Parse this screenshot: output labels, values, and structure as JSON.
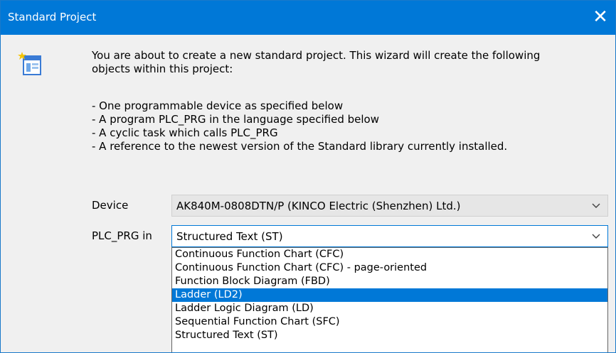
{
  "window": {
    "title": "Standard Project",
    "close_glyph": "✕"
  },
  "intro": "You are about to create a new standard project. This wizard will create the following\nobjects within this project:",
  "bullets": [
    "- One programmable device as specified below",
    "- A program PLC_PRG in the language specified below",
    "- A cyclic task which calls PLC_PRG",
    "- A reference to the newest version of the Standard library currently installed."
  ],
  "device": {
    "label": "Device",
    "value": "AK840M-0808DTN/P (KINCO Electric (Shenzhen) Ltd.)"
  },
  "language": {
    "label": "PLC_PRG in",
    "value": "Structured Text (ST)",
    "options": [
      "Continuous Function Chart (CFC)",
      "Continuous Function Chart (CFC) - page-oriented",
      "Function Block Diagram (FBD)",
      "Ladder (LD2)",
      "Ladder Logic Diagram (LD)",
      "Sequential Function Chart (SFC)",
      "Structured Text (ST)"
    ],
    "highlighted": "Ladder (LD2)"
  },
  "colors": {
    "titlebar": "#0078d7",
    "highlight": "#0078d7",
    "dialog_bg": "#f0f0f0"
  },
  "icons": [
    "close-icon",
    "wizard-icon",
    "chevron-down-icon"
  ]
}
